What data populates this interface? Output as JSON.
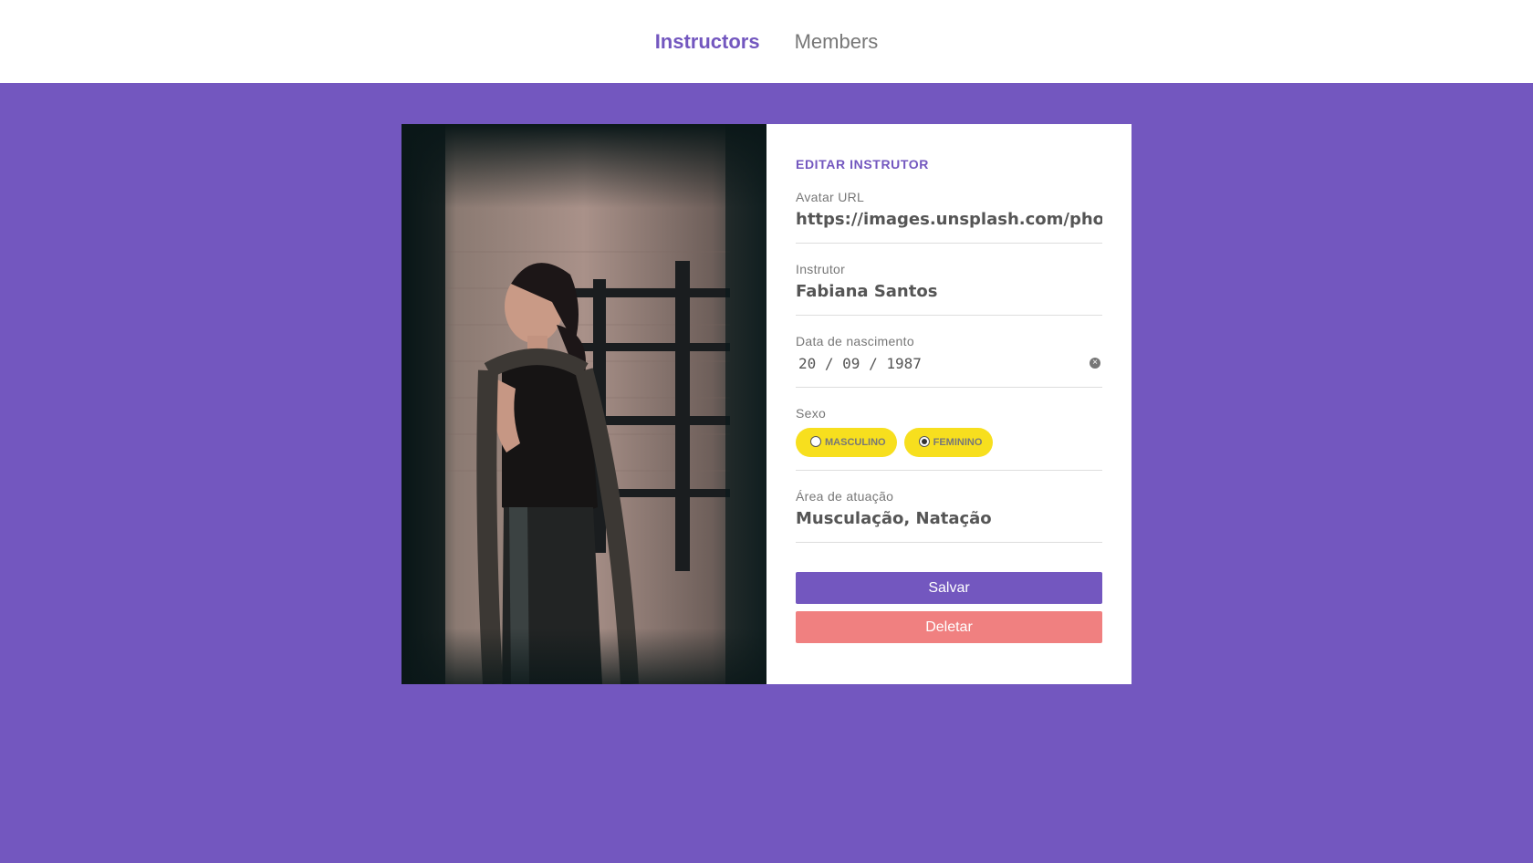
{
  "nav": {
    "items": [
      {
        "label": "Instructors",
        "active": true
      },
      {
        "label": "Members",
        "active": false
      }
    ]
  },
  "form": {
    "title": "EDITAR INSTRUTOR",
    "avatar": {
      "label": "Avatar URL",
      "value": "https://images.unsplash.com/photo-"
    },
    "instructor": {
      "label": "Instrutor",
      "value": "Fabiana Santos"
    },
    "birth": {
      "label": "Data de nascimento",
      "value": "20 / 09 / 1987"
    },
    "gender": {
      "label": "Sexo",
      "options": [
        {
          "label": "MASCULINO",
          "checked": false
        },
        {
          "label": "FEMININO",
          "checked": true
        }
      ]
    },
    "area": {
      "label": "Área de atuação",
      "value": "Musculação, Natação"
    },
    "save_label": "Salvar",
    "delete_label": "Deletar"
  },
  "colors": {
    "primary": "#7357bf",
    "accent_yellow": "#f7df1e",
    "danger": "#f08080",
    "text": "#555555",
    "muted": "#777777"
  }
}
